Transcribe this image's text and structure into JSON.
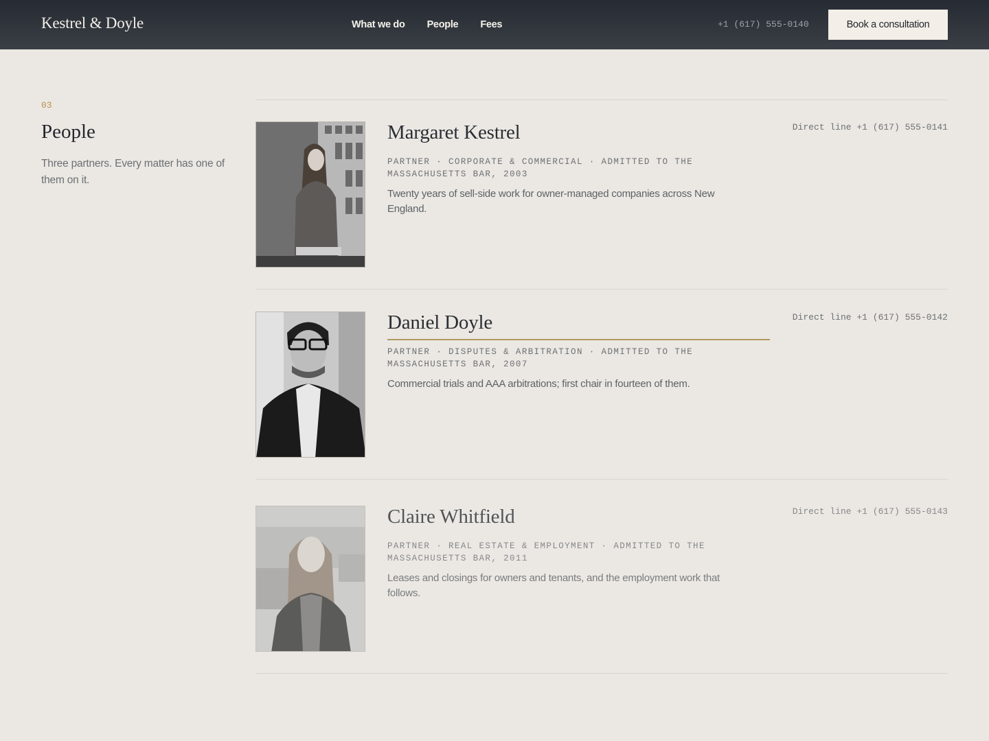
{
  "header": {
    "brand": "Kestrel & Doyle",
    "nav": [
      "What we do",
      "People",
      "Fees"
    ],
    "phone": "+1 (617) 555-0140",
    "cta_label": "Book a consultation"
  },
  "section": {
    "number": "03",
    "title": "People",
    "description": "Three partners. Every matter has one of them on it."
  },
  "people": [
    {
      "name": "Margaret Kestrel",
      "meta": "Partner · Corporate & Commercial · Admitted to the Massachusetts Bar, 2003",
      "bio": "Twenty years of sell-side work for owner-managed companies across New England.",
      "direct": "Direct line +1 (617) 555-0141",
      "photo_icon": "portrait-photo"
    },
    {
      "name": "Daniel Doyle",
      "meta": "Partner · Disputes & Arbitration · Admitted to the Massachusetts Bar, 2007",
      "bio": "Commercial trials and AAA arbitrations; first chair in fourteen of them.",
      "direct": "Direct line +1 (617) 555-0142",
      "photo_icon": "portrait-photo"
    },
    {
      "name": "Claire Whitfield",
      "meta": "Partner · Real Estate & Employment · Admitted to the Massachusetts Bar, 2011",
      "bio": "Leases and closings for owners and tenants, and the employment work that follows.",
      "direct": "Direct line +1 (617) 555-0143",
      "photo_icon": "portrait-photo"
    }
  ],
  "colors": {
    "accent": "#b39863",
    "background": "#ebe8e3",
    "header": "#2f343b"
  }
}
